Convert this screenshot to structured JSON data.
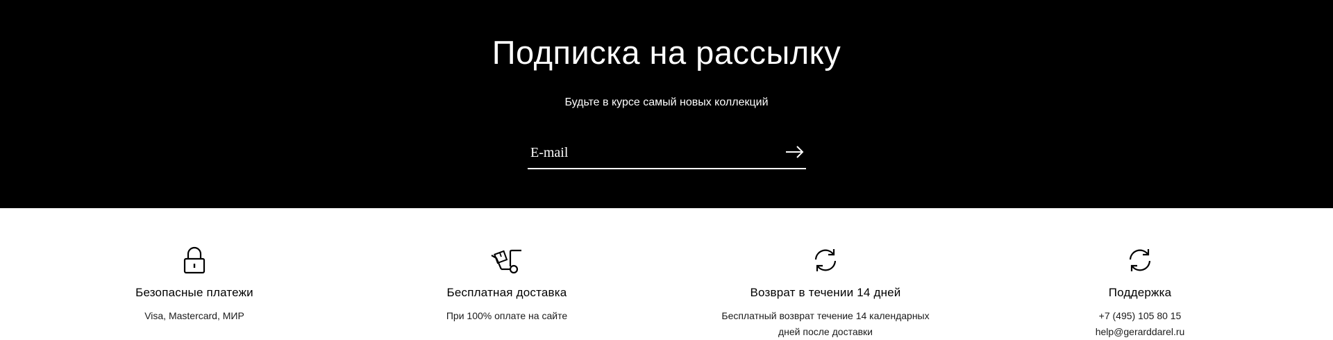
{
  "newsletter": {
    "title": "Подписка на рассылку",
    "subtitle": "Будьте в курсе самый новых коллекций",
    "email_placeholder": "E-mail",
    "submit_icon": "arrow-right-icon"
  },
  "features": [
    {
      "icon": "lock-icon",
      "title": "Безопасные платежи",
      "lines": [
        "Visa, Mastercard, МИР"
      ]
    },
    {
      "icon": "delivery-cart-icon",
      "title": "Бесплатная доставка",
      "lines": [
        "При 100% оплате на сайте"
      ]
    },
    {
      "icon": "refresh-icon",
      "title": "Возврат в течении 14 дней",
      "lines": [
        "Бесплатный возврат течение 14 календарных",
        "дней после доставки"
      ]
    },
    {
      "icon": "refresh-icon",
      "title": "Поддержка",
      "lines": [
        "+7 (495) 105 80 15",
        "help@gerarddarel.ru"
      ]
    }
  ],
  "colors": {
    "newsletter_background": "#000000",
    "newsletter_text": "#ffffff",
    "features_background": "#ffffff",
    "features_text": "#000000"
  }
}
